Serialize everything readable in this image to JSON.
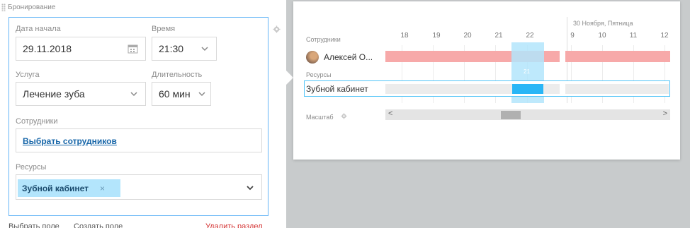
{
  "section": {
    "title": "Бронирование"
  },
  "form": {
    "start_date": {
      "label": "Дата начала",
      "value": "29.11.2018"
    },
    "time": {
      "label": "Время",
      "value": "21:30"
    },
    "service": {
      "label": "Услуга",
      "value": "Лечение зуба"
    },
    "duration": {
      "label": "Длительность",
      "value": "60 мин"
    },
    "employees": {
      "label": "Сотрудники",
      "link": "Выбрать сотрудников"
    },
    "resources": {
      "label": "Ресурсы",
      "tag": "Зубной кабинет",
      "tag_remove": "×"
    }
  },
  "footer": {
    "select_field": "Выбрать поле",
    "create_field": "Создать поле",
    "delete_section": "Удалить раздел"
  },
  "timeline": {
    "day_label": "30 Ноября, Пятница",
    "employees_label": "Сотрудники",
    "resources_label": "Ресурсы",
    "hours": [
      "18",
      "19",
      "20",
      "21",
      "22",
      "9",
      "10",
      "11",
      "12"
    ],
    "employee_name": "Алексей О...",
    "resource_name": "Зубной кабинет",
    "marker_hour": "21",
    "scale_label": "Масштаб"
  },
  "colors": {
    "accent": "#64b5f6",
    "busy": "#f7a9a9",
    "selection": "#29b6f6",
    "danger": "#d32f2f"
  }
}
